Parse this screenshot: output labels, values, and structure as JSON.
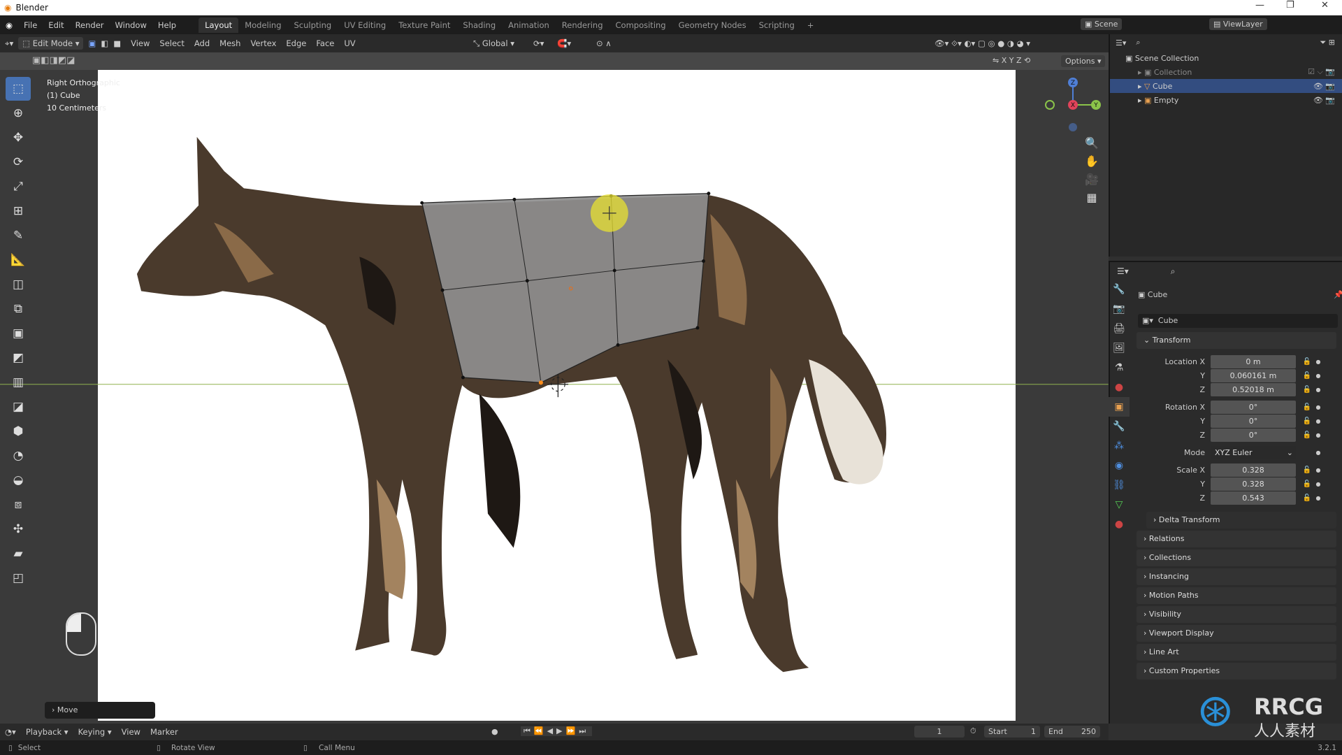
{
  "window": {
    "title": "Blender",
    "version": "3.2.1"
  },
  "menu": [
    "File",
    "Edit",
    "Render",
    "Window",
    "Help"
  ],
  "workspaces": [
    "Layout",
    "Modeling",
    "Sculpting",
    "UV Editing",
    "Texture Paint",
    "Shading",
    "Animation",
    "Rendering",
    "Compositing",
    "Geometry Nodes",
    "Scripting",
    "+"
  ],
  "scene": "Scene",
  "view_layer": "ViewLayer",
  "header": {
    "mode": "Edit Mode",
    "items": [
      "View",
      "Select",
      "Add",
      "Mesh",
      "Vertex",
      "Edge",
      "Face",
      "UV"
    ],
    "orientation": "Global",
    "options": "Options"
  },
  "viewport": {
    "view_name": "Right Orthographic",
    "object": "(1) Cube",
    "scale": "10 Centimeters",
    "axes": {
      "x": "X",
      "y": "Y",
      "z": "Z"
    },
    "axis_colors": {
      "x": "#e0435a",
      "y": "#8bc34a",
      "z": "#4f7fd6"
    }
  },
  "outliner": {
    "root": "Scene Collection",
    "items": [
      {
        "name": "Collection"
      },
      {
        "name": "Cube",
        "selected": true
      },
      {
        "name": "Empty"
      }
    ]
  },
  "properties": {
    "object_name": "Cube",
    "data_name": "Cube",
    "transform_label": "Transform",
    "location": {
      "label": "Location X",
      "x": "0 m",
      "y": "0.060161 m",
      "z": "0.52018 m"
    },
    "rotation": {
      "label": "Rotation X",
      "x": "0°",
      "y": "0°",
      "z": "0°"
    },
    "mode": {
      "label": "Mode",
      "value": "XYZ Euler"
    },
    "scale": {
      "label": "Scale X",
      "x": "0.328",
      "y": "0.328",
      "z": "0.543"
    },
    "axis_y": "Y",
    "axis_z": "Z",
    "delta": "Delta Transform",
    "sections": [
      "Relations",
      "Collections",
      "Instancing",
      "Motion Paths",
      "Visibility",
      "Viewport Display",
      "Line Art",
      "Custom Properties"
    ]
  },
  "last_op": "Move",
  "timeline": {
    "menus": [
      "Playback",
      "Keying",
      "View",
      "Marker"
    ],
    "current_frame": "1",
    "start_label": "Start",
    "start": "1",
    "end_label": "End",
    "end": "250"
  },
  "status": {
    "select": "Select",
    "rotate": "Rotate View",
    "menu": "Call Menu"
  },
  "watermark": {
    "text": "RRCG",
    "sub": "人人素材"
  }
}
